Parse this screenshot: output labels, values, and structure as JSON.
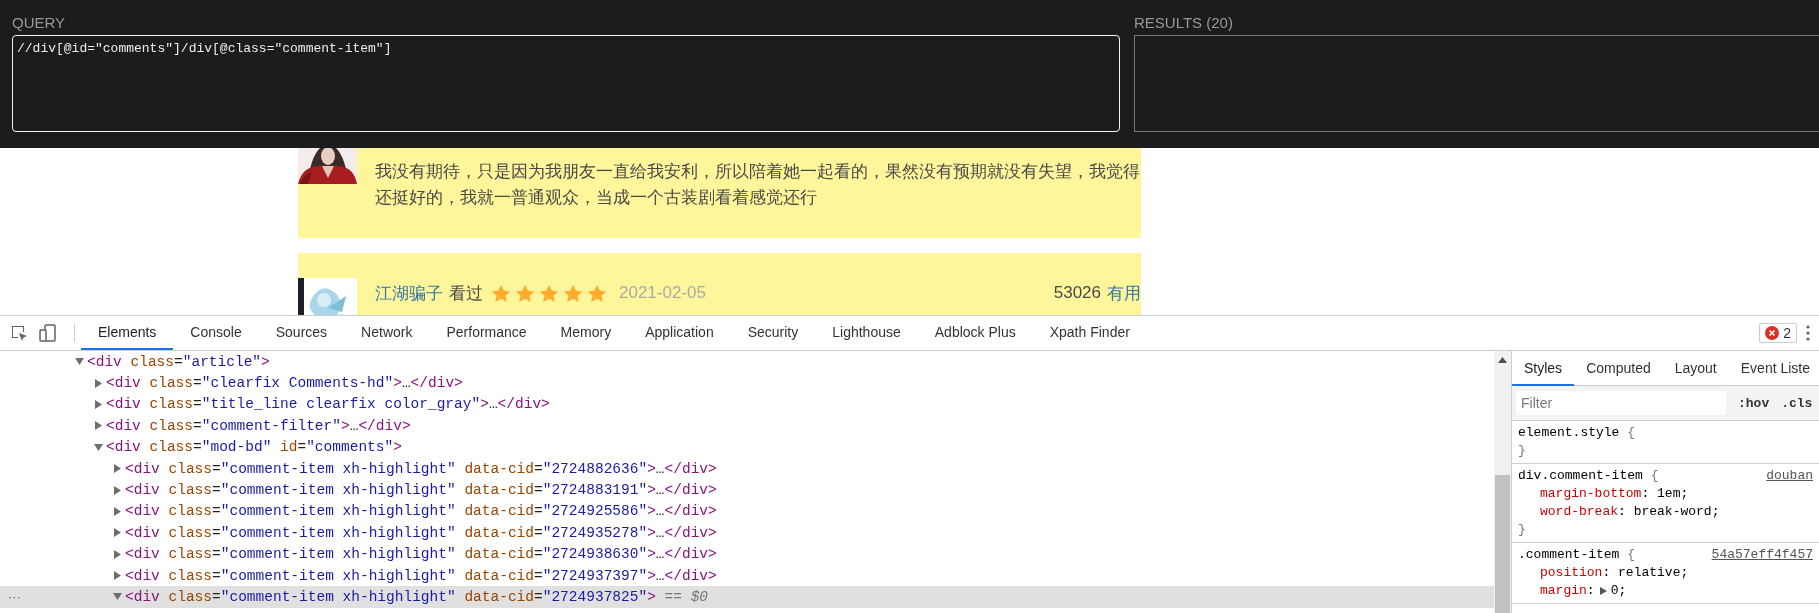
{
  "xpath_finder": {
    "query_label": "QUERY",
    "query": "//div[@id=\"comments\"]/div[@class=\"comment-item\"]",
    "results_label": "RESULTS (20)"
  },
  "comments": [
    {
      "kind": "text",
      "text": "我没有期待，只是因为我朋友一直给我安利，所以陪着她一起看的，果然没有预期就没有失望，我觉得还挺好的，我就一普通观众，当成一个古装剧看着感觉还行"
    },
    {
      "kind": "header",
      "user": "江湖骗子",
      "status": "看过",
      "stars": 5,
      "date": "2021-02-05",
      "votes": "53026",
      "vote_label": "有用"
    }
  ],
  "devtools": {
    "tabs": [
      {
        "label": "Elements",
        "selected": true
      },
      {
        "label": "Console",
        "selected": false
      },
      {
        "label": "Sources",
        "selected": false
      },
      {
        "label": "Network",
        "selected": false
      },
      {
        "label": "Performance",
        "selected": false
      },
      {
        "label": "Memory",
        "selected": false
      },
      {
        "label": "Application",
        "selected": false
      },
      {
        "label": "Security",
        "selected": false
      },
      {
        "label": "Lighthouse",
        "selected": false
      },
      {
        "label": "Adblock Plus",
        "selected": false
      },
      {
        "label": "Xpath Finder",
        "selected": false
      }
    ],
    "error_count": "2",
    "dom_tree": [
      {
        "expanded": true,
        "selected": false,
        "code": [
          {
            "kind": "tag",
            "text": "<div"
          },
          {
            "kind": "attr",
            "text": " class"
          },
          {
            "kind": "punct",
            "text": "="
          },
          {
            "kind": "value",
            "text": "\"article\""
          },
          {
            "kind": "tag",
            "text": ">"
          }
        ],
        "children": [
          {
            "expanded": false,
            "selected": false,
            "code": [
              {
                "kind": "tag",
                "text": "<div"
              },
              {
                "kind": "attr",
                "text": " class"
              },
              {
                "kind": "punct",
                "text": "="
              },
              {
                "kind": "value",
                "text": "\"clearfix Comments-hd\""
              },
              {
                "kind": "tag",
                "text": ">"
              },
              {
                "kind": "punct",
                "text": "…"
              },
              {
                "kind": "tag",
                "text": "</div>"
              }
            ]
          },
          {
            "expanded": false,
            "selected": false,
            "code": [
              {
                "kind": "tag",
                "text": "<div"
              },
              {
                "kind": "attr",
                "text": " class"
              },
              {
                "kind": "punct",
                "text": "="
              },
              {
                "kind": "value",
                "text": "\"title_line clearfix color_gray\""
              },
              {
                "kind": "tag",
                "text": ">"
              },
              {
                "kind": "punct",
                "text": "…"
              },
              {
                "kind": "tag",
                "text": "</div>"
              }
            ]
          },
          {
            "expanded": false,
            "selected": false,
            "code": [
              {
                "kind": "tag",
                "text": "<div"
              },
              {
                "kind": "attr",
                "text": " class"
              },
              {
                "kind": "punct",
                "text": "="
              },
              {
                "kind": "value",
                "text": "\"comment-filter\""
              },
              {
                "kind": "tag",
                "text": ">"
              },
              {
                "kind": "punct",
                "text": "…"
              },
              {
                "kind": "tag",
                "text": "</div>"
              }
            ]
          },
          {
            "expanded": true,
            "selected": false,
            "code": [
              {
                "kind": "tag",
                "text": "<div"
              },
              {
                "kind": "attr",
                "text": " class"
              },
              {
                "kind": "punct",
                "text": "="
              },
              {
                "kind": "value",
                "text": "\"mod-bd\""
              },
              {
                "kind": "attr",
                "text": " id"
              },
              {
                "kind": "punct",
                "text": "="
              },
              {
                "kind": "value",
                "text": "\"comments\""
              },
              {
                "kind": "tag",
                "text": ">"
              }
            ],
            "children": [
              {
                "expanded": false,
                "selected": false,
                "code": [
                  {
                    "kind": "tag",
                    "text": "<div"
                  },
                  {
                    "kind": "attr",
                    "text": " class"
                  },
                  {
                    "kind": "punct",
                    "text": "="
                  },
                  {
                    "kind": "value",
                    "text": "\"comment-item xh-highlight\""
                  },
                  {
                    "kind": "attr",
                    "text": " data-cid"
                  },
                  {
                    "kind": "punct",
                    "text": "="
                  },
                  {
                    "kind": "value",
                    "text": "\"2724882636\""
                  },
                  {
                    "kind": "tag",
                    "text": ">"
                  },
                  {
                    "kind": "punct",
                    "text": "…"
                  },
                  {
                    "kind": "tag",
                    "text": "</div>"
                  }
                ]
              },
              {
                "expanded": false,
                "selected": false,
                "code": [
                  {
                    "kind": "tag",
                    "text": "<div"
                  },
                  {
                    "kind": "attr",
                    "text": " class"
                  },
                  {
                    "kind": "punct",
                    "text": "="
                  },
                  {
                    "kind": "value",
                    "text": "\"comment-item xh-highlight\""
                  },
                  {
                    "kind": "attr",
                    "text": " data-cid"
                  },
                  {
                    "kind": "punct",
                    "text": "="
                  },
                  {
                    "kind": "value",
                    "text": "\"2724883191\""
                  },
                  {
                    "kind": "tag",
                    "text": ">"
                  },
                  {
                    "kind": "punct",
                    "text": "…"
                  },
                  {
                    "kind": "tag",
                    "text": "</div>"
                  }
                ]
              },
              {
                "expanded": false,
                "selected": false,
                "code": [
                  {
                    "kind": "tag",
                    "text": "<div"
                  },
                  {
                    "kind": "attr",
                    "text": " class"
                  },
                  {
                    "kind": "punct",
                    "text": "="
                  },
                  {
                    "kind": "value",
                    "text": "\"comment-item xh-highlight\""
                  },
                  {
                    "kind": "attr",
                    "text": " data-cid"
                  },
                  {
                    "kind": "punct",
                    "text": "="
                  },
                  {
                    "kind": "value",
                    "text": "\"2724925586\""
                  },
                  {
                    "kind": "tag",
                    "text": ">"
                  },
                  {
                    "kind": "punct",
                    "text": "…"
                  },
                  {
                    "kind": "tag",
                    "text": "</div>"
                  }
                ]
              },
              {
                "expanded": false,
                "selected": false,
                "code": [
                  {
                    "kind": "tag",
                    "text": "<div"
                  },
                  {
                    "kind": "attr",
                    "text": " class"
                  },
                  {
                    "kind": "punct",
                    "text": "="
                  },
                  {
                    "kind": "value",
                    "text": "\"comment-item xh-highlight\""
                  },
                  {
                    "kind": "attr",
                    "text": " data-cid"
                  },
                  {
                    "kind": "punct",
                    "text": "="
                  },
                  {
                    "kind": "value",
                    "text": "\"2724935278\""
                  },
                  {
                    "kind": "tag",
                    "text": ">"
                  },
                  {
                    "kind": "punct",
                    "text": "…"
                  },
                  {
                    "kind": "tag",
                    "text": "</div>"
                  }
                ]
              },
              {
                "expanded": false,
                "selected": false,
                "code": [
                  {
                    "kind": "tag",
                    "text": "<div"
                  },
                  {
                    "kind": "attr",
                    "text": " class"
                  },
                  {
                    "kind": "punct",
                    "text": "="
                  },
                  {
                    "kind": "value",
                    "text": "\"comment-item xh-highlight\""
                  },
                  {
                    "kind": "attr",
                    "text": " data-cid"
                  },
                  {
                    "kind": "punct",
                    "text": "="
                  },
                  {
                    "kind": "value",
                    "text": "\"2724938630\""
                  },
                  {
                    "kind": "tag",
                    "text": ">"
                  },
                  {
                    "kind": "punct",
                    "text": "…"
                  },
                  {
                    "kind": "tag",
                    "text": "</div>"
                  }
                ]
              },
              {
                "expanded": false,
                "selected": false,
                "code": [
                  {
                    "kind": "tag",
                    "text": "<div"
                  },
                  {
                    "kind": "attr",
                    "text": " class"
                  },
                  {
                    "kind": "punct",
                    "text": "="
                  },
                  {
                    "kind": "value",
                    "text": "\"comment-item xh-highlight\""
                  },
                  {
                    "kind": "attr",
                    "text": " data-cid"
                  },
                  {
                    "kind": "punct",
                    "text": "="
                  },
                  {
                    "kind": "value",
                    "text": "\"2724937397\""
                  },
                  {
                    "kind": "tag",
                    "text": ">"
                  },
                  {
                    "kind": "punct",
                    "text": "…"
                  },
                  {
                    "kind": "tag",
                    "text": "</div>"
                  }
                ]
              },
              {
                "expanded": true,
                "selected": true,
                "gutter": "···",
                "code": [
                  {
                    "kind": "tag",
                    "text": "<div"
                  },
                  {
                    "kind": "attr",
                    "text": " class"
                  },
                  {
                    "kind": "punct",
                    "text": "="
                  },
                  {
                    "kind": "value",
                    "text": "\"comment-item xh-highlight\""
                  },
                  {
                    "kind": "attr",
                    "text": " data-cid"
                  },
                  {
                    "kind": "punct",
                    "text": "="
                  },
                  {
                    "kind": "value",
                    "text": "\"2724937825\""
                  },
                  {
                    "kind": "tag",
                    "text": ">"
                  },
                  {
                    "kind": "suffix",
                    "text": " == $0"
                  }
                ]
              }
            ]
          }
        ]
      }
    ],
    "styles": {
      "tabs": [
        {
          "label": "Styles",
          "selected": true
        },
        {
          "label": "Computed",
          "selected": false
        },
        {
          "label": "Layout",
          "selected": false
        },
        {
          "label": "Event Liste",
          "selected": false
        }
      ],
      "filter_placeholder": "Filter",
      "hov": ":hov",
      "cls": ".cls",
      "rules": [
        {
          "selector": "element.style",
          "open": "{",
          "close": "}"
        },
        {
          "selector": "div.comment-item",
          "open": "{",
          "source": "douban",
          "declarations": [
            {
              "property": "margin-bottom",
              "colon": ":",
              "value": "1em;"
            },
            {
              "property": "word-break",
              "colon": ":",
              "value": "break-word;"
            }
          ],
          "close": "}"
        },
        {
          "selector": ".comment-item",
          "open": "{",
          "source": "54a57eff4f457",
          "declarations": [
            {
              "property": "position",
              "colon": ":",
              "value": "relative;"
            },
            {
              "property": "margin",
              "colon": ":",
              "expandable": true,
              "value": "0;"
            }
          ]
        }
      ]
    }
  }
}
